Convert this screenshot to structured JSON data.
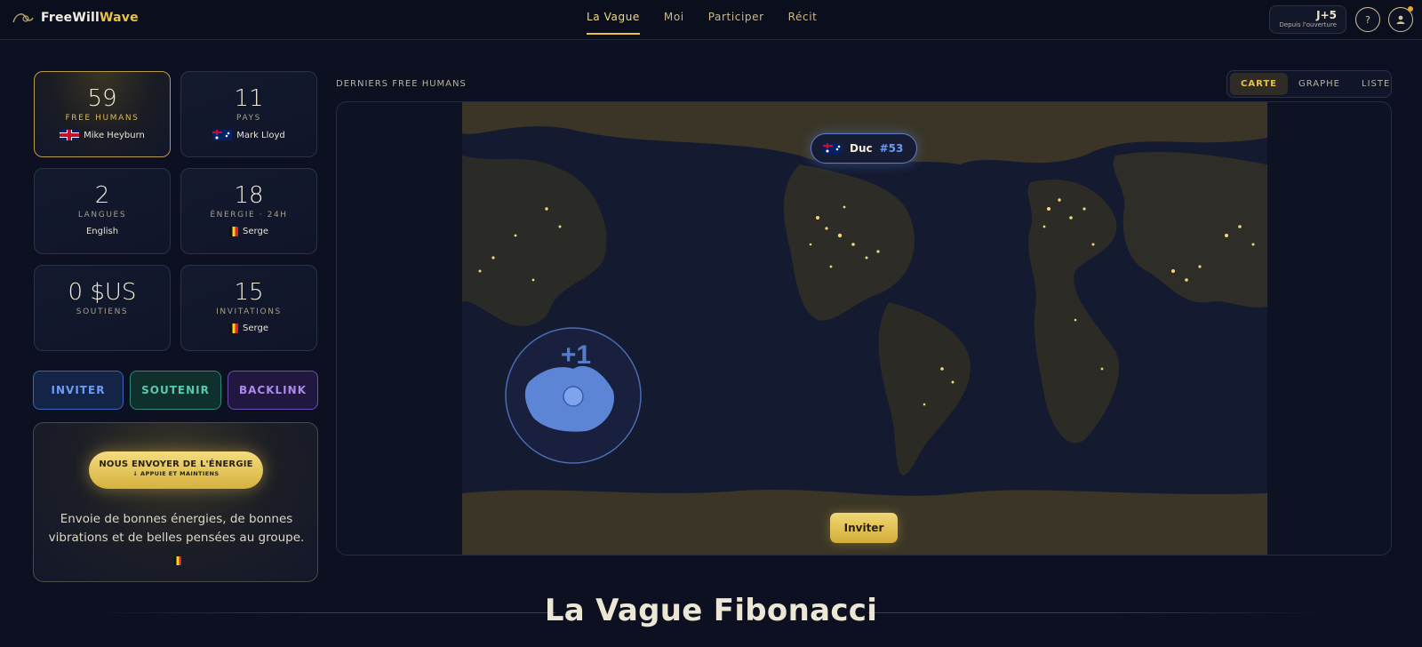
{
  "brand": {
    "name_part1": "FreeWill",
    "name_part2": "Wave",
    "logo_icon": "wave-icon"
  },
  "nav": {
    "items": [
      "La Vague",
      "Moi",
      "Participer",
      "Récit"
    ],
    "active": "La Vague"
  },
  "header": {
    "day_badge": "J+5",
    "day_badge_sub": "Depuis l'ouverture",
    "help_icon": "help-icon",
    "user_icon": "user-icon"
  },
  "stats": [
    {
      "value": "59",
      "label": "FREE HUMANS",
      "person": "Mike Heyburn",
      "flag": "uk"
    },
    {
      "value": "11",
      "label": "PAYS",
      "person": "Mark Lloyd",
      "flag": "au"
    },
    {
      "value": "2",
      "label": "LANGUES",
      "person": "English"
    },
    {
      "value": "18",
      "label": "ÉNERGIE · 24H",
      "person": "Serge",
      "flag": "be"
    },
    {
      "value": "0 $US",
      "label": "SOUTIENS"
    },
    {
      "value": "15",
      "label": "INVITATIONS",
      "person": "Serge",
      "flag": "be"
    }
  ],
  "actions": {
    "invite": "INVITER",
    "support": "SOUTENIR",
    "backlink": "BACKLINK"
  },
  "energy": {
    "button_title": "NOUS ENVOYER DE L'ÉNERGIE",
    "button_sub": "↓ APPUIE ET MAINTIENS",
    "text": "Envoie de bonnes énergies, de bonnes vibrations et de belles pensées au groupe.",
    "flag": "be"
  },
  "map": {
    "title": "DERNIERS FREE HUMANS",
    "tabs": [
      "CARTE",
      "GRAPHE",
      "LISTE"
    ],
    "active_tab": "CARTE",
    "latest": {
      "name": "Duc",
      "number": "#53",
      "flag": "au"
    },
    "highlight_badge": "+1",
    "invite_button": "Inviter"
  },
  "section": {
    "title": "La Vague Fibonacci"
  },
  "colors": {
    "background": "#0c1020",
    "accent_gold": "#e9c24a",
    "accent_blue": "#6f9bf2",
    "accent_teal": "#58c8ae",
    "accent_purple": "#a98be8"
  }
}
